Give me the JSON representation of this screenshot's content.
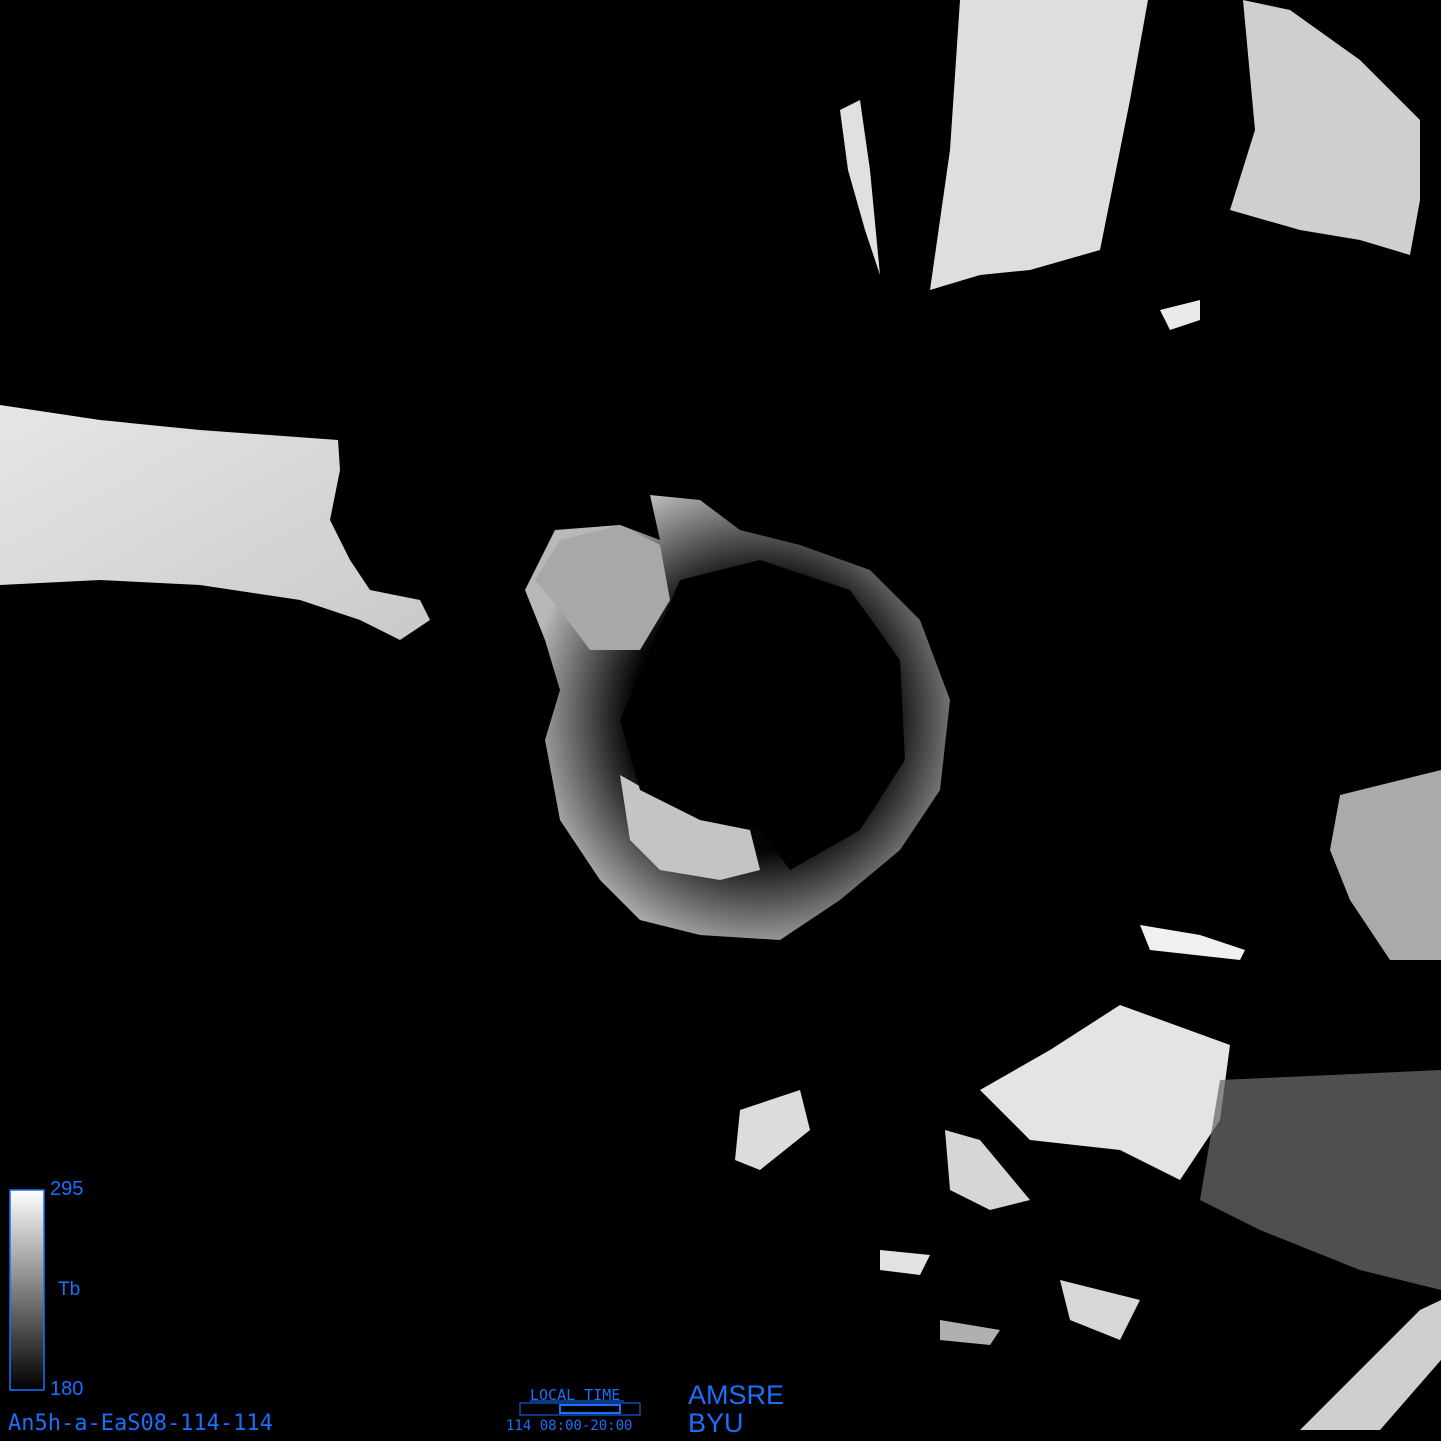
{
  "image": {
    "description_kind": "AMSR-E brightness temperature polar stereographic mosaic",
    "colors": {
      "background": "#000000",
      "label": "#1a6fff"
    }
  },
  "colorbar": {
    "max_label": "295",
    "min_label": "180",
    "title": "Tb",
    "max_value": 295,
    "min_value": 180
  },
  "filename": "An5h-a-EaS08-114-114",
  "local_time": {
    "title": "LOCAL TIME",
    "range": "114  08:00-20:00",
    "day": 114,
    "start": "08:00",
    "end": "20:00"
  },
  "sensor": "AMSRE",
  "organization": "BYU"
}
